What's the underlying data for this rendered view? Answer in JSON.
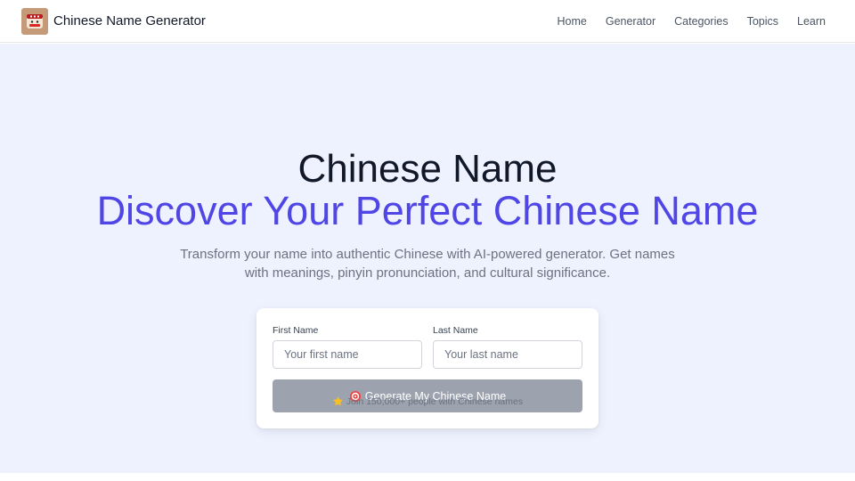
{
  "brand": {
    "name": "Chinese Name Generator",
    "logo_icon": "lantern-face-icon"
  },
  "nav": {
    "items": [
      {
        "label": "Home"
      },
      {
        "label": "Generator"
      },
      {
        "label": "Categories"
      },
      {
        "label": "Topics"
      },
      {
        "label": "Learn"
      }
    ]
  },
  "hero": {
    "title": "Chinese Name",
    "subtitle": "Discover Your Perfect Chinese Name",
    "description": "Transform your name into authentic Chinese with AI-powered generator. Get names with meanings, pinyin pronunciation, and cultural significance."
  },
  "form": {
    "first_name_label": "First Name",
    "first_name_placeholder": "Your first name",
    "first_name_value": "",
    "last_name_label": "Last Name",
    "last_name_placeholder": "Your last name",
    "last_name_value": "",
    "button_label": "Generate My Chinese Name",
    "button_icon": "target-icon"
  },
  "social_proof": {
    "icon": "star-icon",
    "text": "Join 150,000+ people with Chinese names"
  },
  "colors": {
    "accent": "#4f46e5",
    "hero_background": "#eef2ff",
    "button_disabled": "#9ca3af",
    "heading": "#111827",
    "muted_text": "#6b7280"
  }
}
